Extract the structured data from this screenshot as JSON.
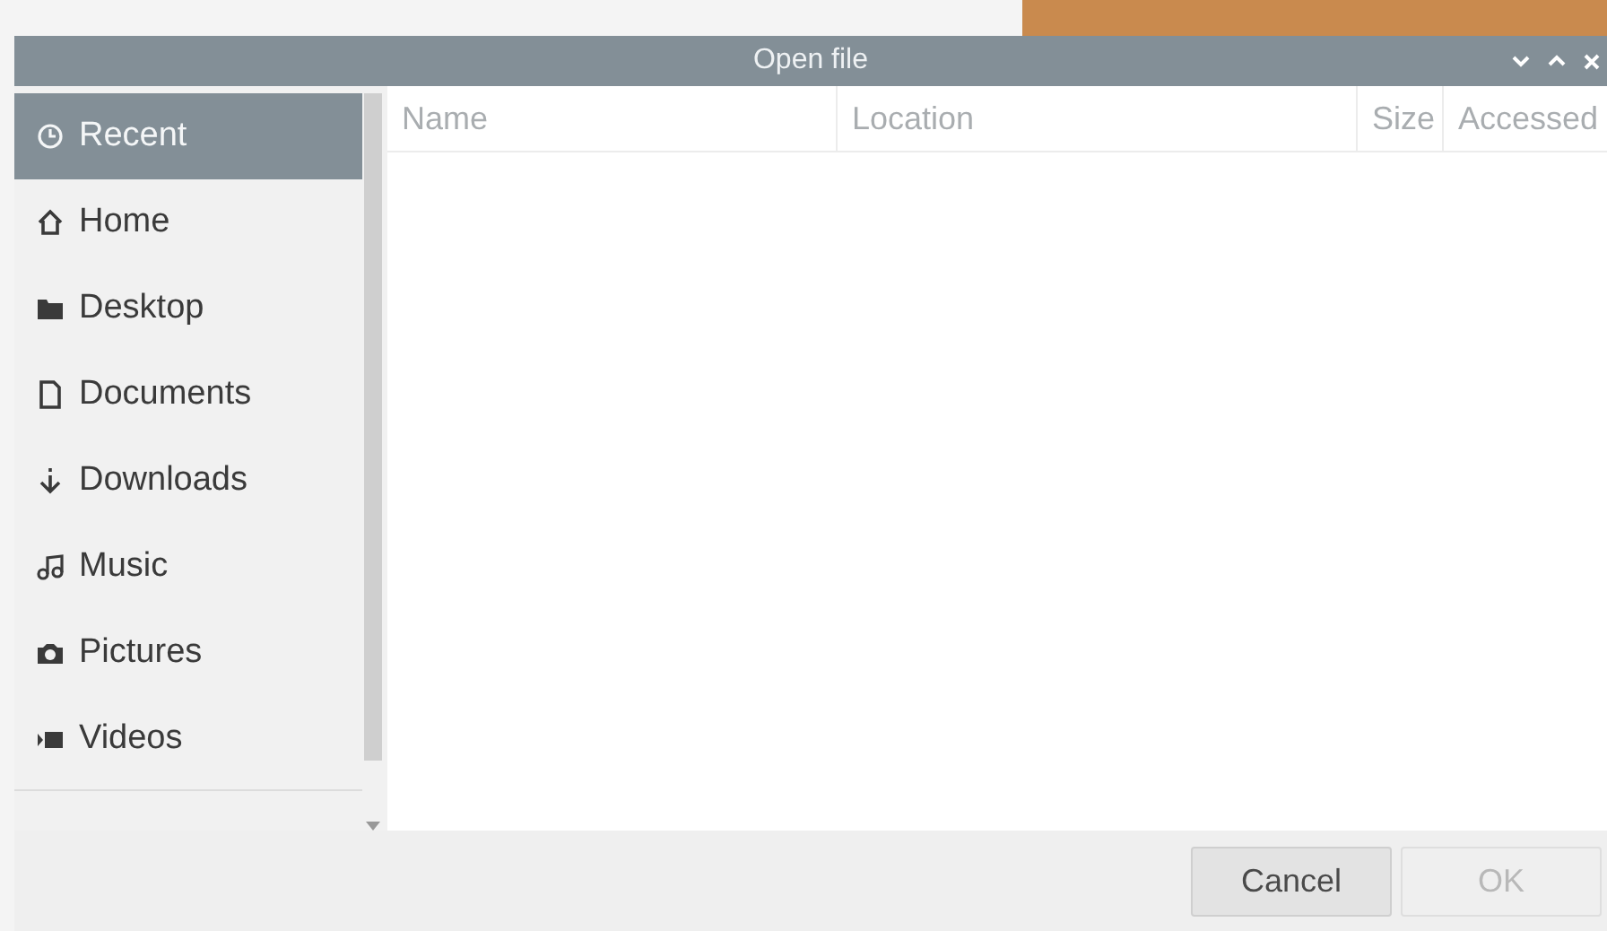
{
  "window": {
    "title": "Open file"
  },
  "sidebar": {
    "items": [
      {
        "label": "Recent",
        "kind": "recent",
        "selected": true
      },
      {
        "label": "Home",
        "kind": "home",
        "selected": false
      },
      {
        "label": "Desktop",
        "kind": "folder",
        "selected": false
      },
      {
        "label": "Documents",
        "kind": "document",
        "selected": false
      },
      {
        "label": "Downloads",
        "kind": "download",
        "selected": false
      },
      {
        "label": "Music",
        "kind": "music",
        "selected": false
      },
      {
        "label": "Pictures",
        "kind": "camera",
        "selected": false
      },
      {
        "label": "Videos",
        "kind": "video",
        "selected": false
      }
    ]
  },
  "table": {
    "columns": [
      "Name",
      "Location",
      "Size",
      "Accessed"
    ]
  },
  "buttons": [
    {
      "label": "Cancel",
      "disabled": false
    },
    {
      "label": "OK",
      "disabled": true
    }
  ]
}
